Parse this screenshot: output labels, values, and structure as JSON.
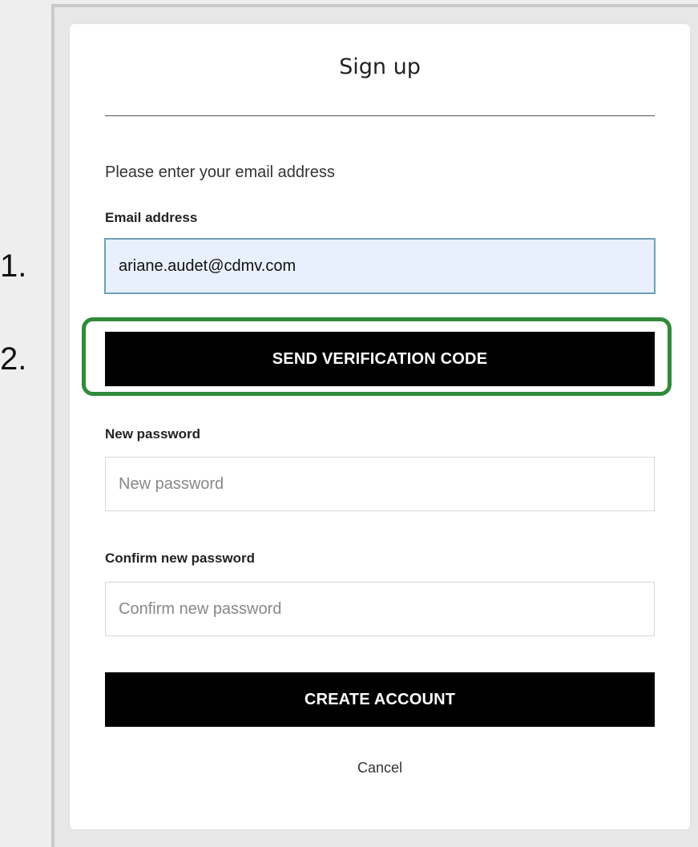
{
  "annotations": {
    "step_1": "1.",
    "step_2": "2.",
    "highlight_color": "#2e8b3a"
  },
  "form": {
    "title": "Sign up",
    "intro": "Please enter your email address",
    "email": {
      "label": "Email address",
      "value": "ariane.audet@cdmv.com"
    },
    "send_code_label": "SEND VERIFICATION CODE",
    "new_password": {
      "label": "New password",
      "placeholder": "New password"
    },
    "confirm_password": {
      "label": "Confirm new password",
      "placeholder": "Confirm new password"
    },
    "create_account_label": "CREATE ACCOUNT",
    "cancel_label": "Cancel"
  }
}
